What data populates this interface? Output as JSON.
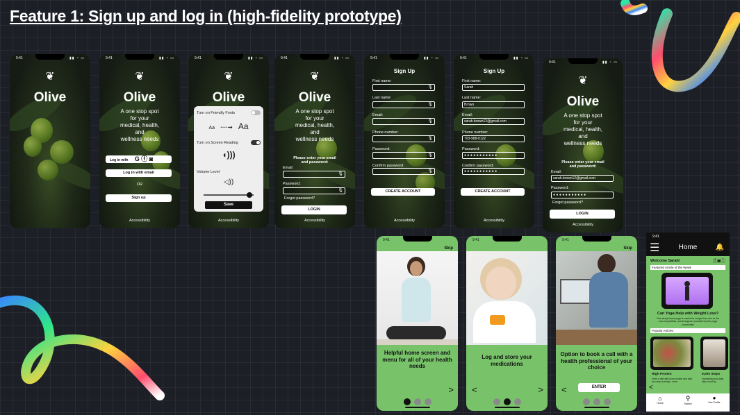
{
  "page": {
    "title": "Feature 1: Sign up and log in (high-fidelity prototype)"
  },
  "status": {
    "time": "9:41",
    "icons": "▮▮ ◔ ▭"
  },
  "brand": {
    "name": "Olive",
    "glyph": "❦",
    "tagline_1": "A one stop spot",
    "tagline_2": "for your",
    "tagline_3": "medical, health,",
    "tagline_4": "and",
    "tagline_5": "wellness needs"
  },
  "common": {
    "accessibility": "Accessibility",
    "mic_glyph": "🎙"
  },
  "screen2": {
    "login_with": "Log in with",
    "social_icons": "G ⓕ ◙",
    "login_email": "Log in with email",
    "or": "OR",
    "signup": "Sign up"
  },
  "screen3": {
    "friendly_fonts": "Turn on Friendly Fonts",
    "font_small": "Aa",
    "font_arrow": "····➞",
    "font_large": "Aa",
    "screen_reading": "Turn on Screen Reading",
    "speaker_glyph": "◖)))",
    "volume_label": "Volume Level",
    "volume_glyph": "◁))",
    "volume_level": 0.92,
    "save": "Save"
  },
  "login": {
    "prompt_1": "Please enter your email",
    "prompt_2": "and password:",
    "email_label": "Email:",
    "password_label": "Password:",
    "forgot": "Forgot password?",
    "login_button": "LOGIN",
    "filled_email": "sarah.brown12@gmail.com",
    "filled_password": "● ● ● ● ● ● ● ● ● ● ●"
  },
  "signup": {
    "title": "Sign Up",
    "first_name": "First name:",
    "last_name": "Last name:",
    "email": "Email:",
    "phone": "Phone number:",
    "password": "Password:",
    "confirm": "Confirm password:",
    "create": "CREATE ACCOUNT",
    "filled": {
      "first_name": "Sarah",
      "last_name": "Brown",
      "email": "sarah.brown12@gmail.com",
      "phone": "703-988-0122",
      "password": "● ● ● ● ● ● ● ● ● ● ●",
      "confirm": "● ● ● ● ● ● ● ● ● ● ●"
    }
  },
  "onboarding": {
    "skip": "Skip",
    "next": ">",
    "prev": "<",
    "slide1": "Helpful home screen and menu for all of your health needs",
    "slide2": "Log and store your medications",
    "slide3": "Option to book a call with a health professional of your choice",
    "enter": "ENTER"
  },
  "home": {
    "title": "Home",
    "menu_glyph": "☰",
    "bell_glyph": "🔔",
    "welcome": "Welcome Sarah!",
    "social": "ⓕ◙ⓣ",
    "featured_label": "Featured Article of the Week",
    "featured_title": "Can Yoga Help with Weight Loss?",
    "featured_desc": "One study found yoga is useful for weight loss due to the non-competitive, social support provided by the yoga community.",
    "popular_label": "Popular Articles",
    "card1_title": "High Protein",
    "card1_desc": "Enter a diet with more protein and help you stop cravings...more",
    "card2_title": "9,000 Steps",
    "card2_desc": "Increasing your daily step count by...",
    "back": "<",
    "nav": [
      {
        "glyph": "⌂",
        "label": "Home"
      },
      {
        "glyph": "⚲",
        "label": "Search"
      },
      {
        "glyph": "●",
        "label": "Use Profile"
      }
    ]
  }
}
